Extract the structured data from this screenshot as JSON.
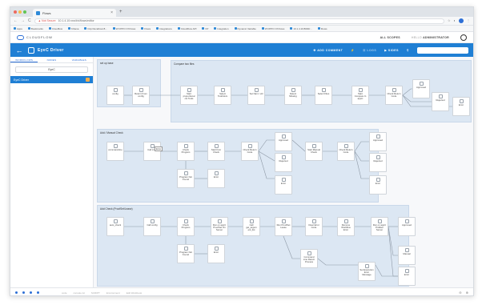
{
  "browser": {
    "tab_title": "Flows",
    "tab_close": "×",
    "new_tab": "+",
    "nav": [
      "←",
      "→",
      "C"
    ],
    "not_secure": "▲ Not Secure",
    "url": "10.1.4.10:xxx/#/s/flows/editor",
    "toolbar_icons": [
      "☆",
      "◐",
      "⋮"
    ],
    "bookmarks": [
      "Apps",
      "Bookmarks",
      "Cloudflow",
      "Kibana",
      "http://localhost:8...",
      "W FPPO Of Flows",
      "Flows",
      "Integrations",
      "CloudFlow API",
      "FP",
      "Integration",
      "Dynamic Variable",
      "W FPPO Of Flows",
      "10.1.4.10:8000/...",
      "Flows"
    ]
  },
  "app": {
    "brand": "CLOUDFLOW",
    "all_scopes": "ALL SCOPES",
    "user_label": "HELLO",
    "user_name": "ADMINISTRATOR"
  },
  "toolbar": {
    "title": "EyeC Driver",
    "add_comment": "ADD COMMENT",
    "logs": "LOGS",
    "bundle": "SIDES",
    "search_placeholder": ""
  },
  "sidebar": {
    "tabs": [
      "WORKFLOWS",
      "NODES",
      "VARIABLES"
    ],
    "select_value": "EyeC",
    "items": [
      {
        "label": "EyeC Driver"
      }
    ]
  },
  "canvas": {
    "tooltip": "Error",
    "groups": [
      {
        "label": "set up base"
      },
      {
        "label": "Compare two files"
      },
      {
        "label": "Add / Manual Check"
      },
      {
        "label": "Add Check (ProofSet/Lease)"
      }
    ],
    "nodes": [
      {
        "label": "config"
      },
      {
        "label": "Return From config"
      },
      {
        "label": "Start proportional cst Tools"
      },
      {
        "label": "Select ToolsVers"
      },
      {
        "label": "Set Nam / util"
      },
      {
        "label": "Detect Missing"
      },
      {
        "label": "Select Files"
      },
      {
        "label": "Start Compare In appC"
      },
      {
        "label": "Check Return Code"
      },
      {
        "label": "Approved"
      },
      {
        "label": "Rejected"
      },
      {
        "label": "Error"
      },
      {
        "label": "command-line"
      },
      {
        "label": "Call cnfig"
      },
      {
        "label": "Check Program"
      },
      {
        "label": "Start from Check"
      },
      {
        "label": "Check Return Code"
      },
      {
        "label": "Approved"
      },
      {
        "label": "Start Manual Check"
      },
      {
        "label": "Check Return Code"
      },
      {
        "label": "Approved"
      },
      {
        "label": "Program Not Found"
      },
      {
        "label": "Error"
      },
      {
        "label": "Rejected"
      },
      {
        "label": "Rejected"
      },
      {
        "label": "Error"
      },
      {
        "label": "Error"
      },
      {
        "label": "auto_check"
      },
      {
        "label": "Call config"
      },
      {
        "label": "Check Program"
      },
      {
        "label": "Run on appC ProofSet On Server"
      },
      {
        "label": "Call get_argum ent_list"
      },
      {
        "label": "Run ProofSet Lease"
      },
      {
        "label": "Clear Error Code"
      },
      {
        "label": "Remove Workflow Error"
      },
      {
        "label": "Run on appC Prolliser Server"
      },
      {
        "label": "Approved"
      },
      {
        "label": "Program Not Found"
      },
      {
        "label": "Error"
      },
      {
        "label": "Command Line Return Process"
      },
      {
        "label": "Manual"
      },
      {
        "label": "Set Execution Error Message"
      },
      {
        "label": "Error"
      }
    ]
  },
  "statusbar": {
    "links": [
      "code",
      "console.txt",
      "SCRIPT",
      "Environment",
      "Edit Workbook"
    ],
    "zoom": [
      "⊖",
      "⊕"
    ]
  },
  "colors": {
    "accent": "#1f7fd4",
    "group_bg": "#dce7f3"
  }
}
